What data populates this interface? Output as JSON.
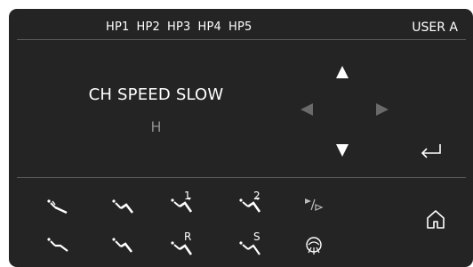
{
  "header": {
    "handpieces": [
      "HP1",
      "HP2",
      "HP3",
      "HP4",
      "HP5"
    ],
    "user": "USER A"
  },
  "mode": {
    "title": "CH SPEED SLOW",
    "subtitle": "H"
  },
  "nav": {
    "up": {
      "icon": "triangle-up-icon",
      "enabled": true
    },
    "down": {
      "icon": "triangle-down-icon",
      "enabled": true
    },
    "left": {
      "icon": "triangle-left-icon",
      "enabled": false
    },
    "right": {
      "icon": "triangle-right-icon",
      "enabled": false
    },
    "enter": {
      "icon": "enter-return-icon"
    },
    "home": {
      "icon": "home-icon"
    }
  },
  "instruments": {
    "row1": [
      {
        "icon": "syringe-icon",
        "label": ""
      },
      {
        "icon": "turbine-icon",
        "label": ""
      },
      {
        "icon": "micromotor-icon",
        "label": "1"
      },
      {
        "icon": "micromotor-icon",
        "label": "2"
      },
      {
        "icon": "play-pause-icon",
        "label": ""
      }
    ],
    "row2": [
      {
        "icon": "scaler-icon",
        "label": ""
      },
      {
        "icon": "handpiece-icon",
        "label": ""
      },
      {
        "icon": "micromotor-icon",
        "label": "R"
      },
      {
        "icon": "micromotor-icon",
        "label": "S"
      },
      {
        "icon": "curing-light-icon",
        "label": ""
      }
    ]
  },
  "colors": {
    "panel": "#242424",
    "text": "#ffffff",
    "dim_text": "#8c8c8c",
    "disabled_arrow": "#6a6a6a",
    "divider": "#5a5a5a"
  }
}
